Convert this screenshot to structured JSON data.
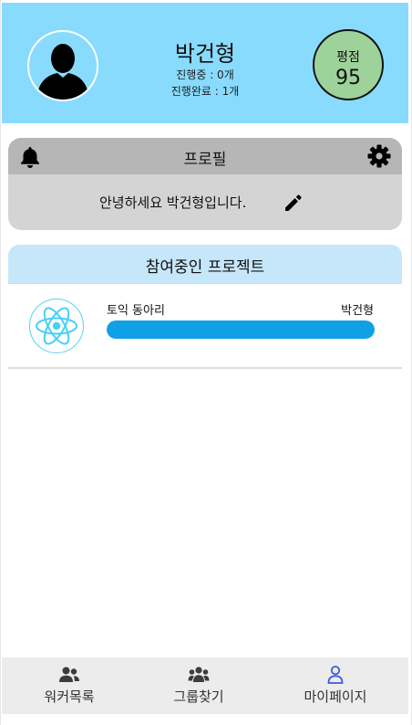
{
  "profile": {
    "name": "박건형",
    "in_progress": "진행중 : 0개",
    "completed": "진행완료 : 1개",
    "rating_label": "평점",
    "rating_value": "95"
  },
  "profile_card": {
    "title": "프로필",
    "greeting": "안녕하세요 박건형입니다.",
    "icons": [
      "bell-icon",
      "gear-icon",
      "pencil-icon"
    ]
  },
  "projects": {
    "title": "참여중인 프로젝트",
    "items": [
      {
        "name": "토익 동아리",
        "owner": "박건형",
        "icon": "react-logo-icon",
        "progress": 1.0
      }
    ]
  },
  "bottom_nav": {
    "items": [
      {
        "label": "워커목록",
        "icon": "users-icon"
      },
      {
        "label": "그룹찾기",
        "icon": "group-icon"
      },
      {
        "label": "마이페이지",
        "icon": "user-outline-icon",
        "active": true
      }
    ]
  },
  "colors": {
    "header_bg": "#88dbfd",
    "rating_bg": "#9dd39a",
    "profile_head_bg": "#b6b6b6",
    "profile_body_bg": "#d4d4d4",
    "project_head_bg": "#c6e6fa",
    "progress": "#0fa0e6",
    "active_icon": "#3b5bd6",
    "nav_bg": "#ececec"
  }
}
